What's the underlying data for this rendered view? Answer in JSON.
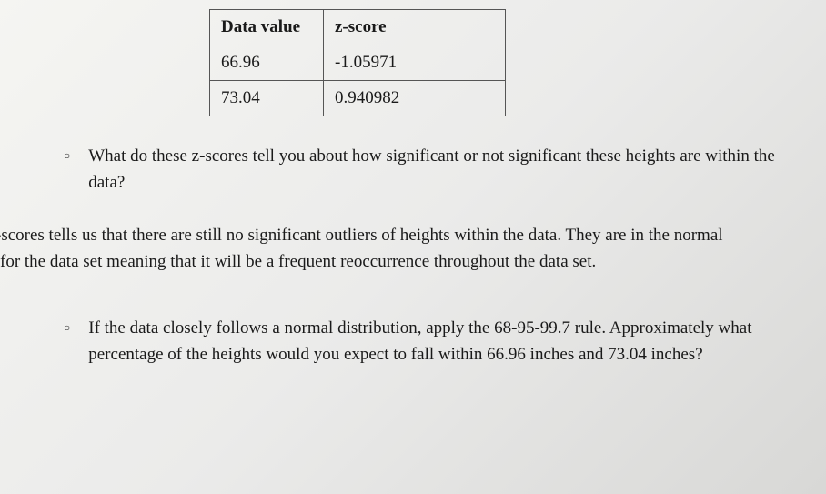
{
  "chart_data": {
    "type": "table",
    "headers": [
      "Data value",
      "z-score"
    ],
    "rows": [
      {
        "data_value": "66.96",
        "z_score": "-1.05971"
      },
      {
        "data_value": "73.04",
        "z_score": "0.940982"
      }
    ]
  },
  "table": {
    "header1": "Data value",
    "header2": "z-score",
    "row1_col1": "66.96",
    "row1_col2": "-1.05971",
    "row2_col1": "73.04",
    "row2_col2": "0.940982"
  },
  "bullets": {
    "circle": "○"
  },
  "question1": {
    "text": "What do these z-scores tell you about how significant or not significant these heights are within the data?"
  },
  "answer1": {
    "line1": "-scores tells us that there are still no significant outliers of heights within the data. They are in the normal",
    "line2": "for the data set meaning that it will be a frequent reoccurrence throughout the data set."
  },
  "question2": {
    "text": "If the data closely follows a normal distribution, apply the 68-95-99.7 rule. Approximately what percentage of the heights would you expect to fall within 66.96 inches and 73.04 inches?"
  }
}
